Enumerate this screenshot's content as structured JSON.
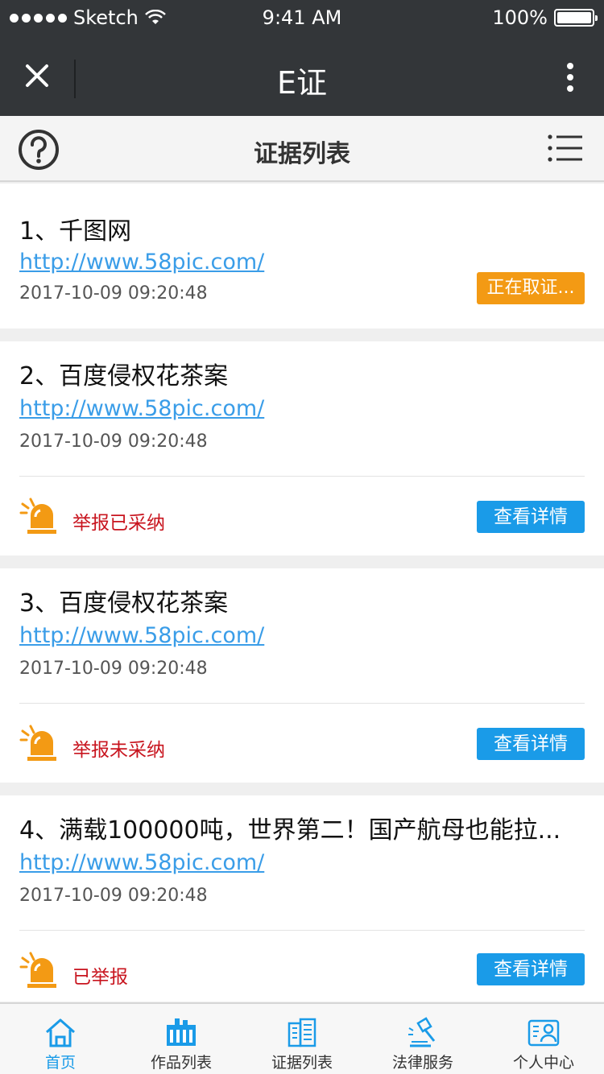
{
  "status_bar": {
    "carrier": "Sketch",
    "time": "9:41 AM",
    "battery": "100%"
  },
  "nav": {
    "title": "E证"
  },
  "subheader": {
    "title": "证据列表"
  },
  "cards": [
    {
      "title": "1、千图网",
      "url": "http://www.58pic.com/",
      "datetime": "2017-10-09   09:20:48",
      "badge": "正在取证..."
    },
    {
      "title": "2、百度侵权花茶案",
      "url": "http://www.58pic.com/",
      "datetime": "2017-10-09   09:20:48",
      "status": "举报已采纳",
      "button": "查看详情"
    },
    {
      "title": "3、百度侵权花茶案",
      "url": "http://www.58pic.com/",
      "datetime": "2017-10-09   09:20:48",
      "status": "举报未采纳",
      "button": "查看详情"
    },
    {
      "title": "4、满载100000吨，世界第二！国产航母也能拉...",
      "url": "http://www.58pic.com/",
      "datetime": "2017-10-09   09:20:48",
      "status": "已举报",
      "button": "查看详情"
    }
  ],
  "tabs": [
    {
      "label": "首页",
      "icon": "home-icon"
    },
    {
      "label": "作品列表",
      "icon": "works-list-icon"
    },
    {
      "label": "证据列表",
      "icon": "evidence-list-icon"
    },
    {
      "label": "法律服务",
      "icon": "legal-service-icon"
    },
    {
      "label": "个人中心",
      "icon": "profile-icon"
    }
  ],
  "colors": {
    "header_bg": "#333639",
    "accent_blue": "#1a9be8",
    "badge_orange": "#f39a14",
    "alarm_orange": "#f39a14",
    "status_red": "#c8141e",
    "link_blue": "#3a9de8"
  }
}
